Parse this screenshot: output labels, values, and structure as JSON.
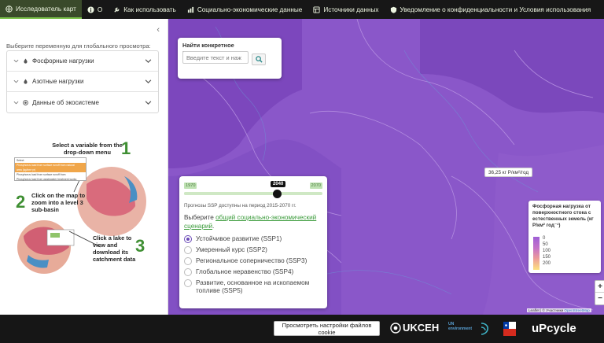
{
  "nav": {
    "items": [
      {
        "label": "Исследователь карт",
        "icon": "map-icon"
      },
      {
        "label": "О",
        "icon": "info-icon"
      },
      {
        "label": "Как использовать",
        "icon": "wrench-icon"
      },
      {
        "label": "Социально-экономические данные",
        "icon": "chart-icon"
      },
      {
        "label": "Источники данных",
        "icon": "database-icon"
      },
      {
        "label": "Уведомление о конфиденциальности и Условия использования",
        "icon": "shield-icon"
      }
    ]
  },
  "sidebar": {
    "heading": "Выберите переменную для глобального просмотра:",
    "items": [
      {
        "label": "Фосфорные нагрузки",
        "icon": "droplet-icon"
      },
      {
        "label": "Азотные нагрузки",
        "icon": "droplet-icon"
      },
      {
        "label": "Данные об экосистеме",
        "icon": "ecosystem-icon"
      }
    ],
    "howto": {
      "step1": "Select a variable from the drop-down menu",
      "step2": "Click on the map to zoom into a level 3 sub-basin",
      "step3": "Click a lake to view and download its catchment data",
      "n1": "1",
      "n2": "2",
      "n3": "3",
      "dropdown_lines": [
        "Select",
        "Phosphorus load from surface runoff from natural",
        "area (kg/km²·yr)",
        "Phosphorus load from surface runoff from",
        "agricultural land (kg P yr-1)",
        "Phosphorus load from wastewater treatment works"
      ]
    }
  },
  "search": {
    "label": "Найти конкретное местоположение",
    "placeholder": "Введите текст и наж"
  },
  "scenario": {
    "year_min": "1970",
    "year_max": "2070",
    "year_selected": "2040",
    "year_fraction": 0.7,
    "note": "Прогнозы SSP доступны на период 2015-2070 гг.",
    "prompt_before": "Выберите ",
    "prompt_link": "общий социально-экономический сценарий",
    "prompt_after": ".",
    "options": [
      {
        "label": "Устойчивое развитие (SSP1)",
        "selected": true
      },
      {
        "label": "Умеренный курс (SSP2)",
        "selected": false
      },
      {
        "label": "Региональное соперничество (SSP3)",
        "selected": false
      },
      {
        "label": "Глобальное неравенство (SSP4)",
        "selected": false
      },
      {
        "label": "Развитие, основанное на ископаемом топливе (SSP5)",
        "selected": false
      }
    ]
  },
  "map": {
    "tooltip": "36,25 кг P/км²/год",
    "colors": {
      "base": "#8a57c9",
      "dark": "#6f3fb0",
      "light": "#a06ad6"
    }
  },
  "legend": {
    "title": "Фосфорная нагрузка от поверхностного стока с естественных земель (кг P/км² год⁻¹)",
    "ticks": [
      "0",
      "50",
      "100",
      "150",
      "200"
    ]
  },
  "zoom": {
    "in": "+",
    "out": "−"
  },
  "attribution": {
    "prefix": "Leaflet | © Участники ",
    "link": "OpenStreetMap"
  },
  "footer": {
    "cookie_button": "Просмотреть настройки файлов cookie",
    "logos": {
      "ukceh": "UKCEH",
      "un": "UN environment",
      "upcycle": "uPcycle"
    }
  }
}
